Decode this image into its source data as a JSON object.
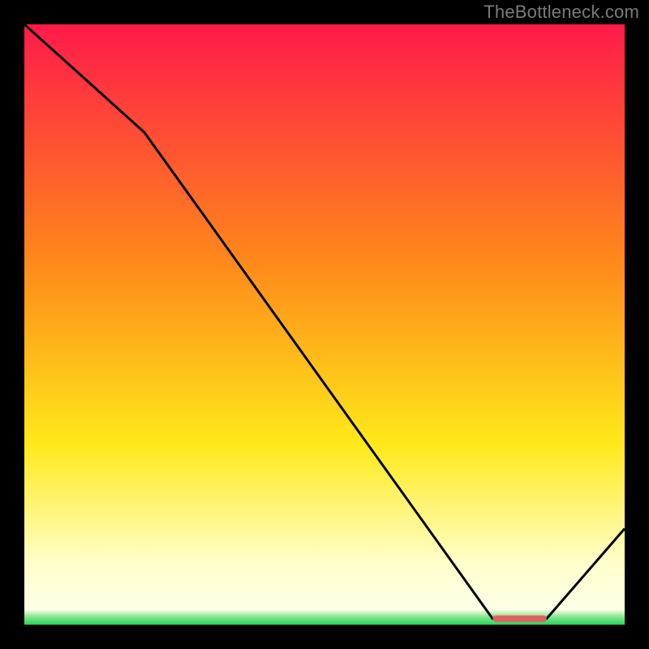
{
  "watermark": "TheBottleneck.com",
  "colors": {
    "frame_bg": "#000000",
    "line": "#000000",
    "gradient_top": "#ff1a4a",
    "gradient_orange": "#ff8a1a",
    "gradient_yellow": "#ffe91a",
    "gradient_pale": "#ffffcc",
    "gradient_green": "#1fd65a",
    "marker": "#e06060",
    "watermark": "#7a7a7a"
  },
  "chart_data": {
    "type": "line",
    "title": "",
    "xlabel": "",
    "ylabel": "",
    "xlim": [
      0,
      100
    ],
    "ylim": [
      0,
      100
    ],
    "x": [
      0,
      20,
      78,
      87,
      100
    ],
    "values": [
      100,
      82,
      1,
      1,
      16
    ],
    "optimum_marker": {
      "x_start": 78,
      "x_end": 87,
      "y": 1
    },
    "gradient_stops": [
      {
        "offset": 0.0,
        "color": "#ff1a4a"
      },
      {
        "offset": 0.4,
        "color": "#ff8a1a"
      },
      {
        "offset": 0.7,
        "color": "#ffe91a"
      },
      {
        "offset": 0.9,
        "color": "#ffffcc"
      },
      {
        "offset": 0.975,
        "color": "#ffffe8"
      },
      {
        "offset": 0.985,
        "color": "#9ae89a"
      },
      {
        "offset": 1.0,
        "color": "#1fd65a"
      }
    ]
  }
}
